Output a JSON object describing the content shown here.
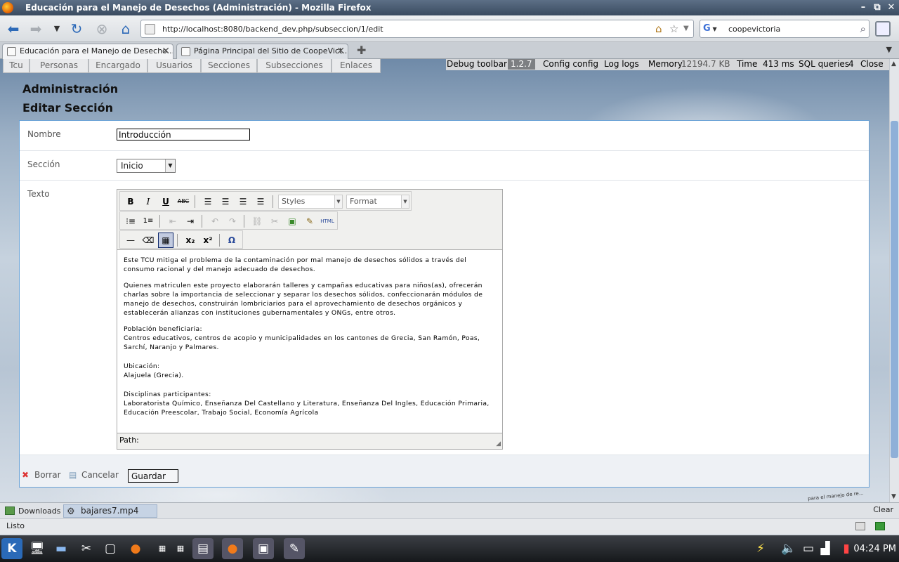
{
  "window": {
    "title": "Educación para el Manejo de Desechos (Administración) - Mozilla Firefox"
  },
  "navbar": {
    "url": "http://localhost:8080/backend_dev.php/subseccion/1/edit",
    "search_value": "coopevictoria"
  },
  "tabs": [
    {
      "label": "Educación para el Manejo de Desecho..."
    },
    {
      "label": "Página Principal del Sitio de CoopeVict..."
    }
  ],
  "admin_tabs": [
    "Tcu",
    "Personas",
    "Encargado",
    "Usuarios",
    "Secciones",
    "Subsecciones",
    "Enlaces"
  ],
  "debug": {
    "toolbar": "Debug toolbar",
    "version": "1.2.7",
    "config": "Config config",
    "logs": "Log logs",
    "memory_label": "Memory",
    "memory_value": "12194.7 KB",
    "time_label": "Time",
    "time_value": "413 ms",
    "sql_label": "SQL queries",
    "sql_value": "4",
    "close": "Close"
  },
  "page": {
    "heading": "Administración",
    "subheading": "Editar Sección"
  },
  "form": {
    "nombre_label": "Nombre",
    "nombre_value": "Introducción",
    "seccion_label": "Sección",
    "seccion_value": "Inicio",
    "texto_label": "Texto"
  },
  "editor": {
    "styles_label": "Styles",
    "format_label": "Format",
    "paragraphs": [
      "Este TCU mitiga el problema de la contaminación por mal manejo de desechos sólidos a través del consumo racional y del manejo adecuado de desechos.",
      "Quienes matriculen este proyecto elaborarán talleres y campañas educativas para niños(as), ofrecerán charlas sobre la importancia de seleccionar y separar los desechos sólidos, confeccionarán módulos de manejo de desechos, construirán lombriciarios para el aprovechamiento de desechos orgánicos y establecerán alianzas con instituciones gubernamentales y ONGs, entre otros.",
      "Población beneficiaria:",
      "Centros educativos, centros de acopio y municipalidades en los cantones de Grecia, San Ramón, Poas, Sarchí, Naranjo y Palmares.",
      "Ubicación:",
      "Alajuela (Grecia).",
      "Disciplinas participantes:",
      "Laboratorista Químico, Enseñanza Del Castellano y Literatura, Enseñanza Del Ingles, Educación Primaria, Educación Preescolar, Trabajo Social, Economía Agrícola"
    ],
    "path_label": "Path:"
  },
  "actions": {
    "delete": "Borrar",
    "cancel": "Cancelar",
    "save": "Guardar"
  },
  "downloads": {
    "button": "Downloads",
    "item": "bajares7.mp4",
    "clear": "Clear"
  },
  "status": {
    "text": "Listo"
  },
  "panel": {
    "clock": "04:24 PM"
  },
  "signature": "para el manejo de re..."
}
